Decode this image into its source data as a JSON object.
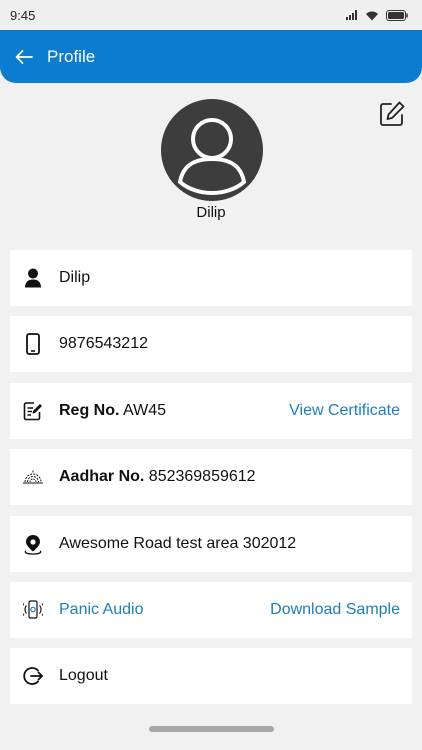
{
  "status_bar": {
    "time": "9:45"
  },
  "app_bar": {
    "title": "Profile"
  },
  "profile": {
    "name": "Dilip"
  },
  "rows": {
    "name": {
      "value": "Dilip"
    },
    "phone": {
      "value": "9876543212"
    },
    "reg": {
      "label": "Reg No.",
      "value": " AW45",
      "action": "View Certificate"
    },
    "aadhar": {
      "label": "Aadhar No.",
      "value": " 852369859612"
    },
    "address": {
      "value": "Awesome Road test area 302012"
    },
    "panic": {
      "label": "Panic Audio",
      "action": "Download Sample"
    },
    "logout": {
      "label": "Logout"
    }
  },
  "colors": {
    "primary": "#0b7ccf",
    "link": "#1a7fc0",
    "background": "#f1f1f1"
  },
  "icons": [
    "back-arrow-icon",
    "edit-icon",
    "avatar-icon",
    "person-icon",
    "phone-icon",
    "document-edit-icon",
    "fingerprint-icon",
    "location-pin-icon",
    "audio-icon",
    "logout-icon"
  ]
}
